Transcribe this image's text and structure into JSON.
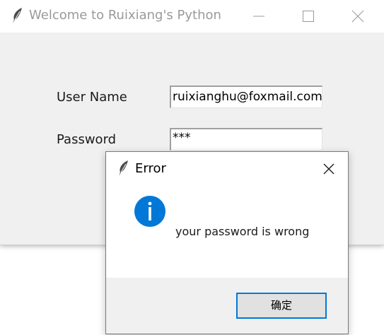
{
  "main_window": {
    "title": "Welcome to Ruixiang's Python",
    "controls": {
      "minimize_icon": "minimize-icon",
      "maximize_icon": "maximize-icon",
      "close_icon": "close-icon"
    },
    "form": {
      "username_label": "User Name",
      "username_value": "ruixianghu@foxmail.com",
      "password_label": "Password",
      "password_value": "***"
    }
  },
  "error_dialog": {
    "title": "Error",
    "icon": "info-icon",
    "message": "your password is wrong",
    "ok_label": "确定"
  },
  "colors": {
    "window_bg": "#f0f0f0",
    "title_text_inactive": "#9a9a9a",
    "info_icon": "#0078d7",
    "button_focus_border": "#0078d7"
  }
}
